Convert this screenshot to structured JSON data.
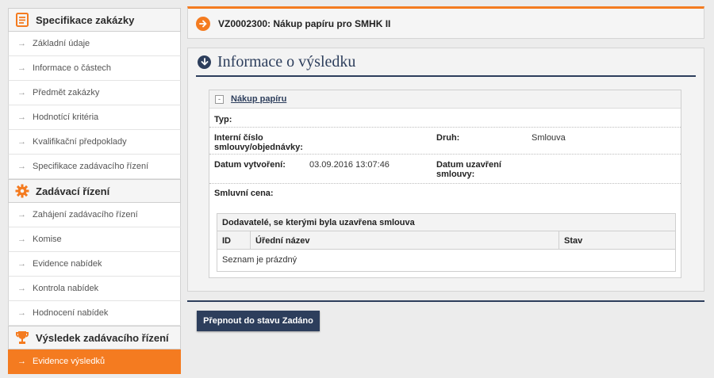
{
  "sidebar": {
    "sections": [
      {
        "title": "Specifikace zakázky",
        "icon": "document-icon",
        "items": [
          {
            "label": "Základní údaje"
          },
          {
            "label": "Informace o částech"
          },
          {
            "label": "Předmět zakázky"
          },
          {
            "label": "Hodnotící kritéria"
          },
          {
            "label": "Kvalifikační předpoklady"
          },
          {
            "label": "Specifikace zadávacího řízení"
          }
        ]
      },
      {
        "title": "Zadávací řízení",
        "icon": "gear-icon",
        "items": [
          {
            "label": "Zahájení zadávacího řízení"
          },
          {
            "label": "Komise"
          },
          {
            "label": "Evidence nabídek"
          },
          {
            "label": "Kontrola nabídek"
          },
          {
            "label": "Hodnocení nabídek"
          }
        ]
      },
      {
        "title": "Výsledek zadávacího řízení",
        "icon": "trophy-icon",
        "items": [
          {
            "label": "Evidence výsledků",
            "active": true
          }
        ]
      }
    ]
  },
  "header": {
    "title": "VZ0002300: Nákup papíru pro SMHK II"
  },
  "panel": {
    "title": "Informace o výsledku",
    "box_title": "Nákup papíru",
    "fields": {
      "typ_label": "Typ:",
      "interni_label": "Interní číslo smlouvy/objednávky:",
      "druh_label": "Druh:",
      "druh_value": "Smlouva",
      "datum_vytvoreni_label": "Datum vytvoření:",
      "datum_vytvoreni_value": "03.09.2016 13:07:46",
      "datum_uzavreni_label": "Datum uzavření smlouvy:",
      "cena_label": "Smluvní cena:"
    },
    "suppliers": {
      "title": "Dodavatelé, se kterými byla uzavřena smlouva",
      "columns": [
        "ID",
        "Úřední název",
        "Stav"
      ],
      "empty_text": "Seznam je prázdný"
    }
  },
  "actions": {
    "switch_label": "Přepnout do stavu Zadáno"
  },
  "colors": {
    "accent": "#f47b20",
    "navy": "#2d3e5c"
  }
}
